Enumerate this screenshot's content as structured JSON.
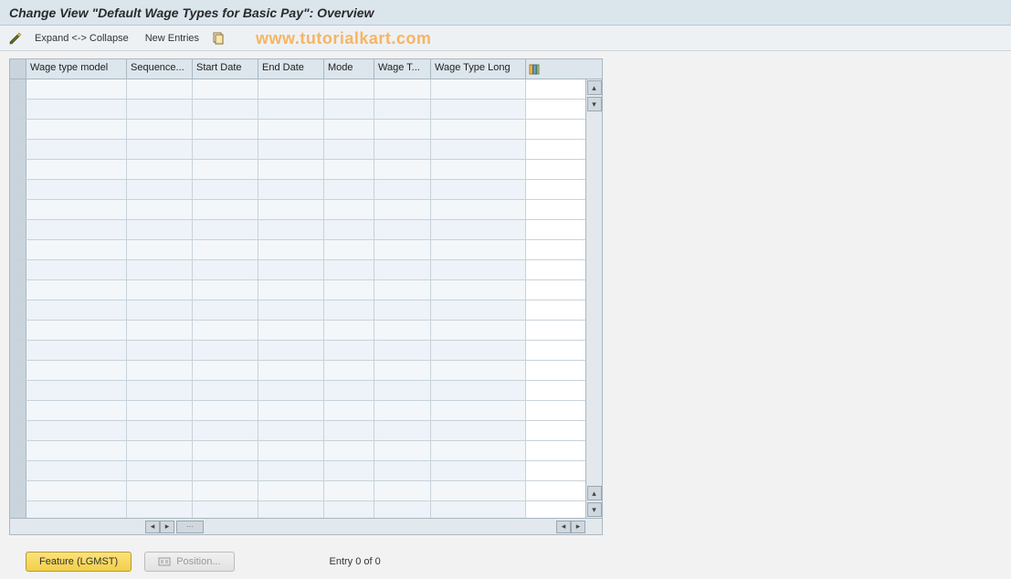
{
  "title": "Change View \"Default Wage Types for Basic Pay\": Overview",
  "toolbar": {
    "expand_collapse": "Expand <-> Collapse",
    "new_entries": "New Entries"
  },
  "watermark": "www.tutorialkart.com",
  "grid": {
    "columns": [
      "Wage type model",
      "Sequence...",
      "Start Date",
      "End Date",
      "Mode",
      "Wage T...",
      "Wage Type Long"
    ],
    "row_count": 22
  },
  "footer": {
    "feature_btn": "Feature (LGMST)",
    "position_btn": "Position...",
    "entry_status": "Entry 0 of 0"
  }
}
